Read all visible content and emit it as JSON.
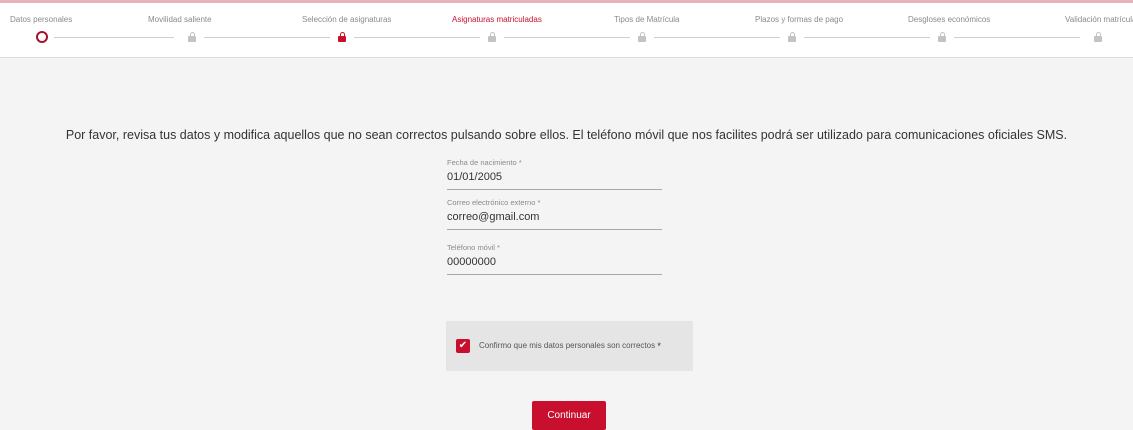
{
  "steps": [
    {
      "label": "Datos personales",
      "state": "current"
    },
    {
      "label": "Movilidad saliente",
      "state": "locked"
    },
    {
      "label": "Selección de asignaturas",
      "state": "locked-active"
    },
    {
      "label": "Asignaturas matriculadas",
      "state": "locked",
      "highlighted": true
    },
    {
      "label": "Tipos de Matrícula",
      "state": "locked"
    },
    {
      "label": "Plazos y formas de pago",
      "state": "locked"
    },
    {
      "label": "Desgloses económicos",
      "state": "locked"
    },
    {
      "label": "Validación matrícula",
      "state": "locked"
    }
  ],
  "intro_text": "Por favor, revisa tus datos y modifica aquellos que no sean correctos pulsando sobre ellos. El teléfono móvil que nos facilites podrá ser utilizado para comunicaciones oficiales SMS.",
  "form": {
    "birth_date": {
      "label": "Fecha de nacimiento *",
      "value": "01/01/2005"
    },
    "email": {
      "label": "Correo electrónico externo *",
      "value": "correo@gmail.com"
    },
    "phone": {
      "label": "Teléfono móvil *",
      "value": "00000000"
    }
  },
  "confirm": {
    "label": "Confirmo que mis datos personales son correctos",
    "required_mark": "*",
    "checked": true
  },
  "continue_label": "Continuar",
  "colors": {
    "accent": "#c8102e",
    "background": "#f4f4f4"
  }
}
